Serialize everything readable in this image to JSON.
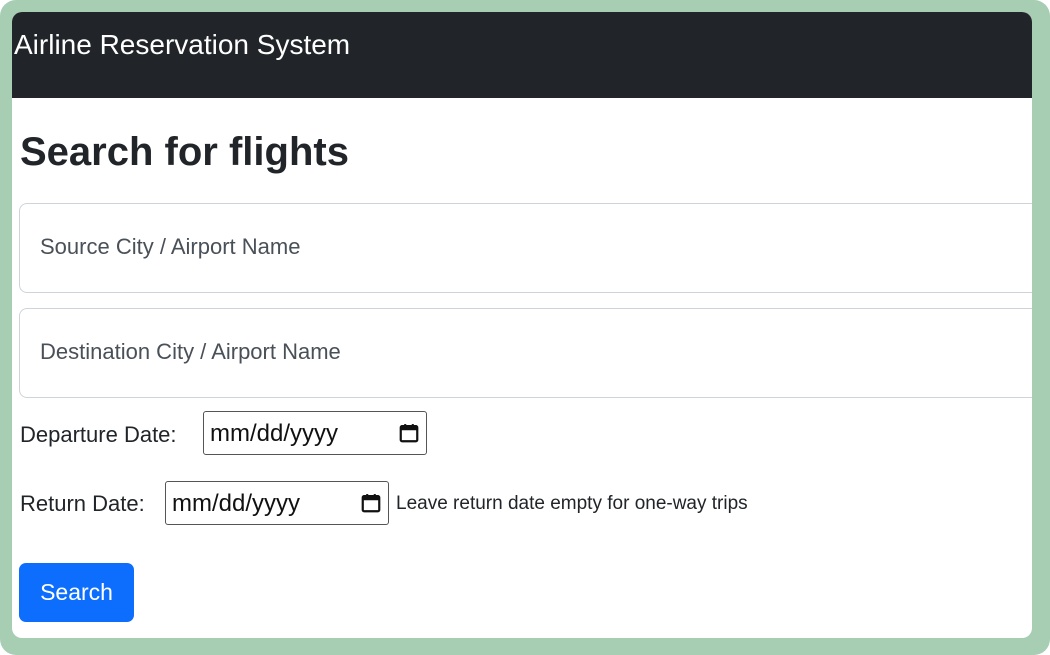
{
  "navbar": {
    "brand": "Airline Reservation System"
  },
  "main": {
    "title": "Search for flights",
    "source": {
      "placeholder": "Source City / Airport Name"
    },
    "destination": {
      "placeholder": "Destination City / Airport Name"
    },
    "departure": {
      "label": "Departure Date:",
      "placeholder": "mm/dd/yyyy",
      "icon": "calendar-icon"
    },
    "return": {
      "label": "Return Date:",
      "placeholder": "mm/dd/yyyy",
      "icon": "calendar-icon",
      "hint": "Leave return date empty for one-way trips"
    },
    "search_label": "Search"
  },
  "colors": {
    "navbar": "#212529",
    "primary": "#0d6efd",
    "frame": "#a7cdb3"
  }
}
